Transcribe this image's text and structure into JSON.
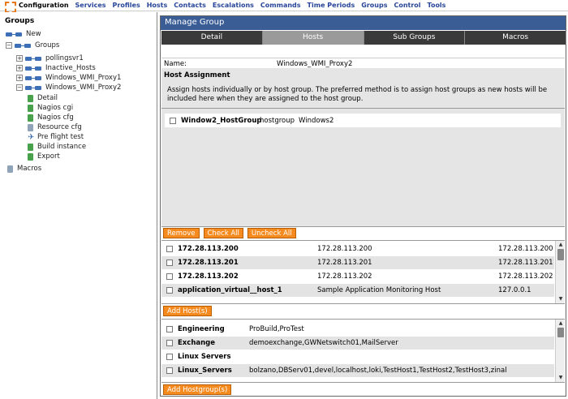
{
  "menu": [
    "Configuration",
    "Services",
    "Profiles",
    "Hosts",
    "Contacts",
    "Escalations",
    "Commands",
    "Time Periods",
    "Groups",
    "Control",
    "Tools"
  ],
  "left": {
    "heading": "Groups",
    "new_label": "New",
    "groups_label": "Groups",
    "items": [
      "pollingsvr1",
      "Inactive_Hosts",
      "Windows_WMI_Proxy1",
      "Windows_WMI_Proxy2"
    ],
    "subitems": [
      "Detail",
      "Nagios cgi",
      "Nagios cfg",
      "Resource cfg",
      "Pre flight test",
      "Build instance",
      "Export"
    ],
    "macros_label": "Macros"
  },
  "panel": {
    "title": "Manage Group",
    "tabs": [
      "Detail",
      "Hosts",
      "Sub Groups",
      "Macros"
    ],
    "name_label": "Name:",
    "name_value": "Windows_WMI_Proxy2",
    "assign_heading": "Host Assignment",
    "assign_desc": "Assign hosts individually or by host group. The preferred method is to assign host groups as new hosts will be included here when they are assigned to the host group.",
    "hostgroup_row": {
      "name": "Window2_HostGroup",
      "type": "hostgroup",
      "value": "Windows2"
    },
    "buttons": {
      "remove": "Remove",
      "check_all": "Check All",
      "uncheck_all": "Uncheck All",
      "add_hosts": "Add Host(s)",
      "add_hostgroups": "Add Hostgroup(s)"
    }
  },
  "hosts": [
    {
      "name": "172.28.113.200",
      "alias": "172.28.113.200",
      "address": "172.28.113.200"
    },
    {
      "name": "172.28.113.201",
      "alias": "172.28.113.201",
      "address": "172.28.113.201"
    },
    {
      "name": "172.28.113.202",
      "alias": "172.28.113.202",
      "address": "172.28.113.202"
    },
    {
      "name": "application_virtual__host_1",
      "alias": "Sample Application Monitoring Host",
      "address": "127.0.0.1"
    }
  ],
  "hostgroups": [
    {
      "name": "Engineering",
      "members": "ProBuild,ProTest"
    },
    {
      "name": "Exchange",
      "members": "demoexchange,GWNetswitch01,MailServer"
    },
    {
      "name": "Linux Servers",
      "members": ""
    },
    {
      "name": "Linux_Servers",
      "members": "bolzano,DBServ01,devel,localhost,loki,TestHost1,TestHost2,TestHost3,zinal"
    }
  ]
}
